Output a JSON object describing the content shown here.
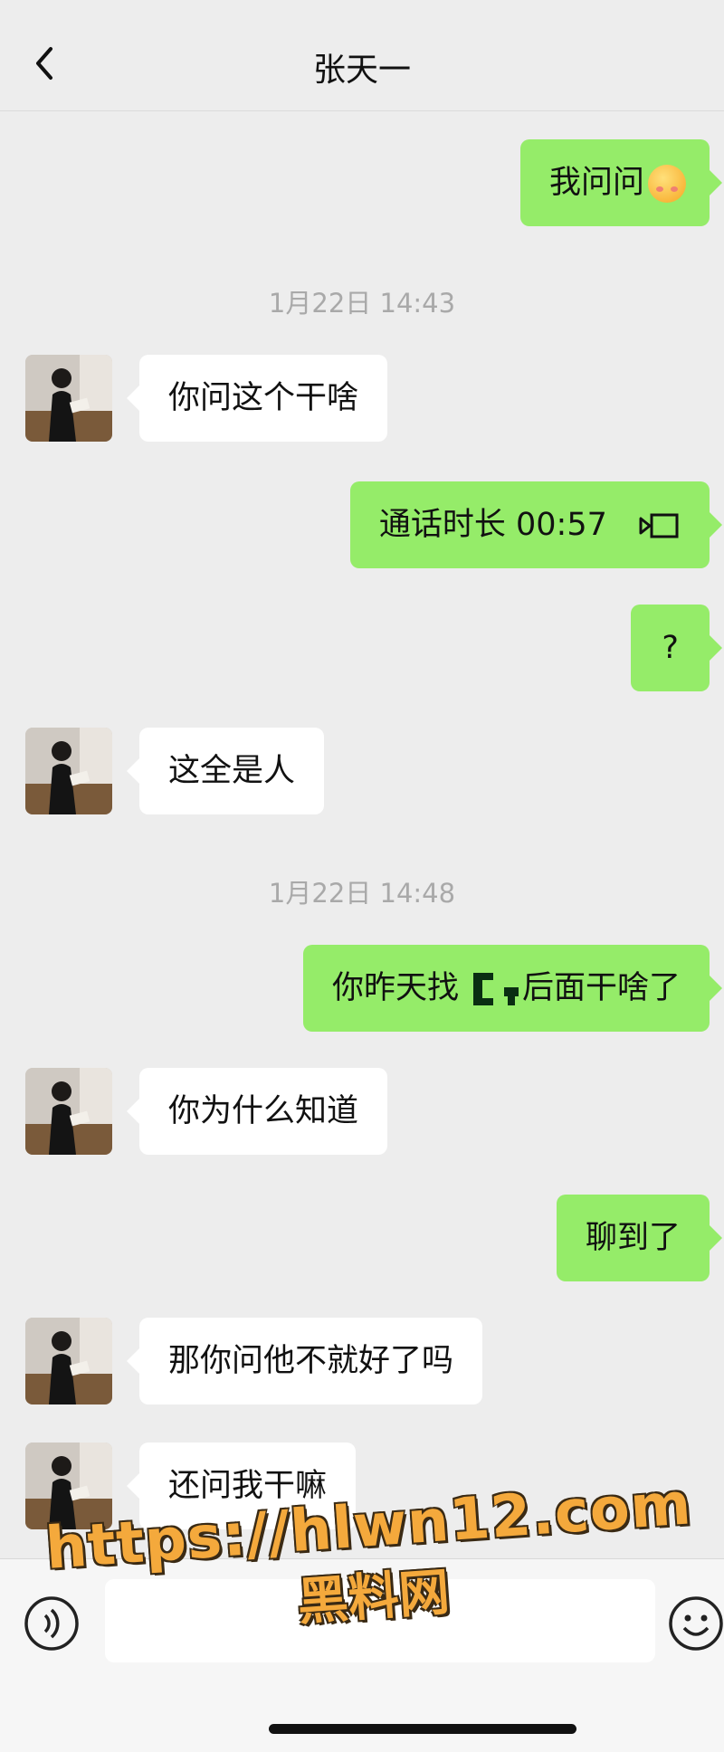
{
  "header": {
    "title": "张天一"
  },
  "messages": [
    {
      "type": "outgoing",
      "text": "我问问",
      "emoji": "emoji-face"
    },
    {
      "type": "timestamp",
      "text": "1月22日 14:43"
    },
    {
      "type": "incoming",
      "text": "你问这个干啥"
    },
    {
      "type": "outgoing",
      "text": "通话时长 00:57",
      "icon": "video-call-icon"
    },
    {
      "type": "outgoing",
      "text": "?"
    },
    {
      "type": "incoming",
      "text": "这全是人"
    },
    {
      "type": "timestamp",
      "text": "1月22日 14:48"
    },
    {
      "type": "outgoing",
      "text_before": "你昨天找",
      "text_after": "后面干啥了"
    },
    {
      "type": "incoming",
      "text": "你为什么知道"
    },
    {
      "type": "outgoing",
      "text": "聊到了"
    },
    {
      "type": "incoming",
      "text": "那你问他不就好了吗"
    },
    {
      "type": "incoming",
      "text": "还问我干嘛"
    }
  ],
  "input": {
    "value": ""
  },
  "watermark": {
    "url": "https://hlwn12.com",
    "site": "黑料网"
  },
  "colors": {
    "background": "#ededed",
    "outgoing_bubble": "#95ec69",
    "incoming_bubble": "#ffffff",
    "timestamp_text": "#a9a9a9"
  }
}
